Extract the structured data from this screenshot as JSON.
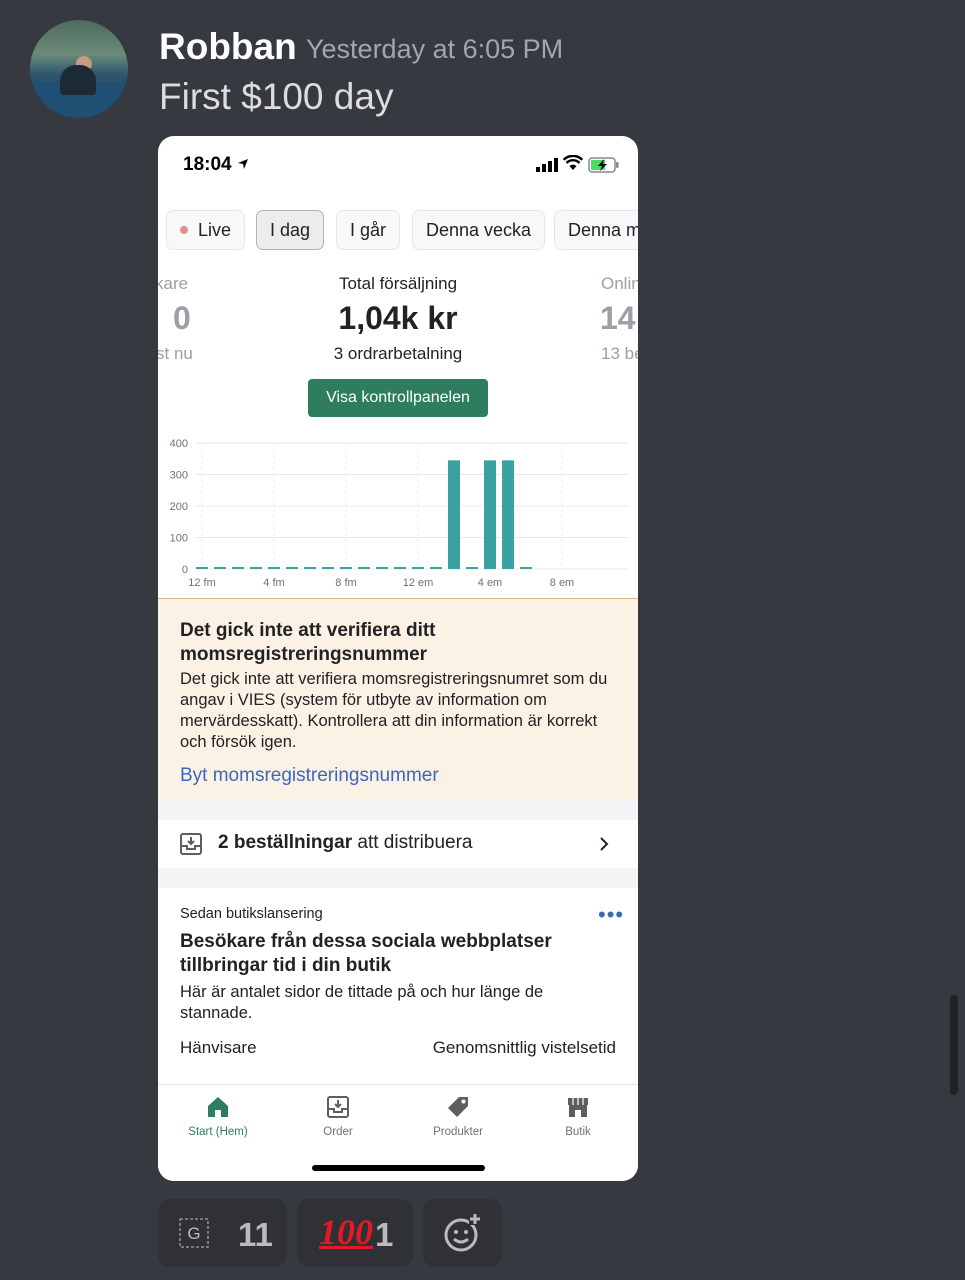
{
  "message": {
    "username": "Robban",
    "timestamp": "Yesterday at 6:05 PM",
    "text": "First $100 day"
  },
  "phone": {
    "status_bar": {
      "time": "18:04"
    },
    "tabs": [
      "Live",
      "I dag",
      "I går",
      "Denna vecka",
      "Denna m"
    ],
    "active_tab": "I dag",
    "metrics": {
      "left": {
        "label": "kare",
        "value": "0",
        "sub": "st nu"
      },
      "center": {
        "label": "Total försäljning",
        "value": "1,04k kr",
        "sub": "3 ordrarbetalning"
      },
      "right": {
        "label": "Onlin",
        "value": "14",
        "sub": "13 be"
      }
    },
    "dashboard_button": "Visa kontrollpanelen",
    "chart_data": {
      "type": "bar",
      "title": "",
      "xlabel": "",
      "ylabel": "",
      "ylim": [
        0,
        400
      ],
      "y_ticks": [
        "0",
        "100",
        "200",
        "300",
        "400"
      ],
      "x_tick_labels": [
        "12 fm",
        "4 fm",
        "8 fm",
        "12 em",
        "4 em",
        "8 em"
      ],
      "categories": [
        "12 fm",
        "1 fm",
        "2 fm",
        "3 fm",
        "4 fm",
        "5 fm",
        "6 fm",
        "7 fm",
        "8 fm",
        "9 fm",
        "10 fm",
        "11 fm",
        "12 em",
        "1 em",
        "2 em",
        "3 em",
        "4 em",
        "5 em",
        "6 em"
      ],
      "values": [
        0,
        0,
        0,
        0,
        0,
        0,
        0,
        0,
        0,
        0,
        0,
        0,
        0,
        0,
        345,
        0,
        345,
        345,
        0
      ],
      "color": "#3aa3a2",
      "grid": true
    },
    "warning_banner": {
      "title": "Det gick inte att verifiera ditt momsregistreringsnummer",
      "body": "Det gick inte att verifiera momsregistreringsnumret som du angav i VIES (system för utbyte av information om mervärdesskatt). Kontrollera att din information är korrekt och försök igen.",
      "link": "Byt momsregistreringsnummer"
    },
    "orders_row": {
      "strong": "2 beställningar",
      "rest": " att distribuera"
    },
    "card": {
      "eyebrow": "Sedan butikslansering",
      "title": "Besökare från dessa sociala webbplatser tillbringar tid i din butik",
      "body": "Här är antalet sidor de tittade på och hur länge de stannade.",
      "col_left": "Hänvisare",
      "col_right": "Genomsnittlig vistelsetid"
    },
    "tab_bar": [
      {
        "label": "Start (Hem)",
        "icon": "home-icon"
      },
      {
        "label": "Order",
        "icon": "order-download-icon"
      },
      {
        "label": "Produkter",
        "icon": "tag-icon"
      },
      {
        "label": "Butik",
        "icon": "store-icon"
      }
    ]
  },
  "reactions": [
    {
      "emoji": "G",
      "count": "11"
    },
    {
      "emoji": "💯",
      "count": "1"
    }
  ]
}
